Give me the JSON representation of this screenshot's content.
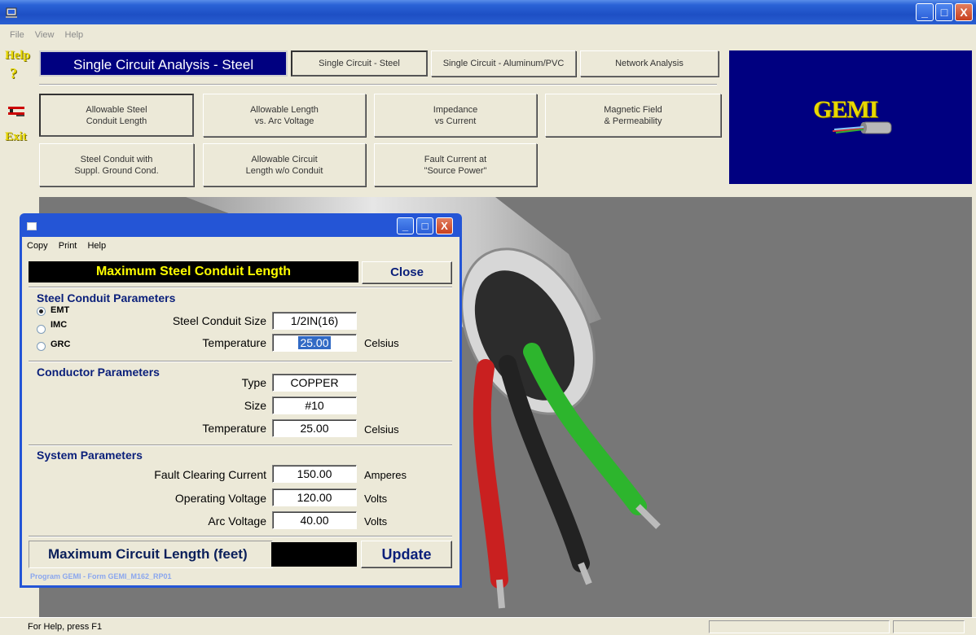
{
  "window": {
    "minimize": "_",
    "maximize": "□",
    "close": "X"
  },
  "menu": [
    "File",
    "View",
    "Help"
  ],
  "rail": {
    "help": "Help",
    "question": "?",
    "exit": "Exit"
  },
  "header": {
    "title": "Single Circuit Analysis - Steel",
    "tabs": [
      "Single Circuit - Steel",
      "Single Circuit - Aluminum/PVC",
      "Network Analysis"
    ]
  },
  "analysis_buttons": [
    {
      "line1": "Allowable Steel",
      "line2": "Conduit Length"
    },
    {
      "line1": "Allowable Length",
      "line2": "vs. Arc Voltage"
    },
    {
      "line1": "Impedance",
      "line2": "vs Current"
    },
    {
      "line1": "Magnetic Field",
      "line2": "& Permeability"
    },
    {
      "line1": "Steel Conduit with",
      "line2": "Suppl. Ground Cond."
    },
    {
      "line1": "Allowable Circuit",
      "line2": "Length w/o Conduit"
    },
    {
      "line1": "Fault Current at",
      "line2": "\"Source Power\""
    }
  ],
  "logo": "GEMI",
  "status": {
    "message": "For Help, press F1"
  },
  "dialog": {
    "menu": [
      "Copy",
      "Print",
      "Help"
    ],
    "title": "Maximum Steel Conduit Length",
    "close_label": "Close",
    "steel": {
      "heading": "Steel Conduit Parameters",
      "radios": [
        {
          "label": "EMT",
          "selected": true
        },
        {
          "label": "IMC",
          "selected": false
        },
        {
          "label": "GRC",
          "selected": false
        }
      ],
      "size_label": "Steel Conduit Size",
      "size_value": "1/2IN(16)",
      "temp_label": "Temperature",
      "temp_value": "25.00",
      "temp_unit": "Celsius"
    },
    "conductor": {
      "heading": "Conductor Parameters",
      "type_label": "Type",
      "type_value": "COPPER",
      "size_label": "Size",
      "size_value": "#10",
      "temp_label": "Temperature",
      "temp_value": "25.00",
      "temp_unit": "Celsius"
    },
    "system": {
      "heading": "System Parameters",
      "fault_label": "Fault Clearing Current",
      "fault_value": "150.00",
      "fault_unit": "Amperes",
      "opv_label": "Operating Voltage",
      "opv_value": "120.00",
      "opv_unit": "Volts",
      "arc_label": "Arc Voltage",
      "arc_value": "40.00",
      "arc_unit": "Volts"
    },
    "result_label": "Maximum Circuit Length (feet)",
    "result_value": "",
    "update_label": "Update",
    "footer": "Program GEMI - Form GEMI_M162_RP01"
  }
}
